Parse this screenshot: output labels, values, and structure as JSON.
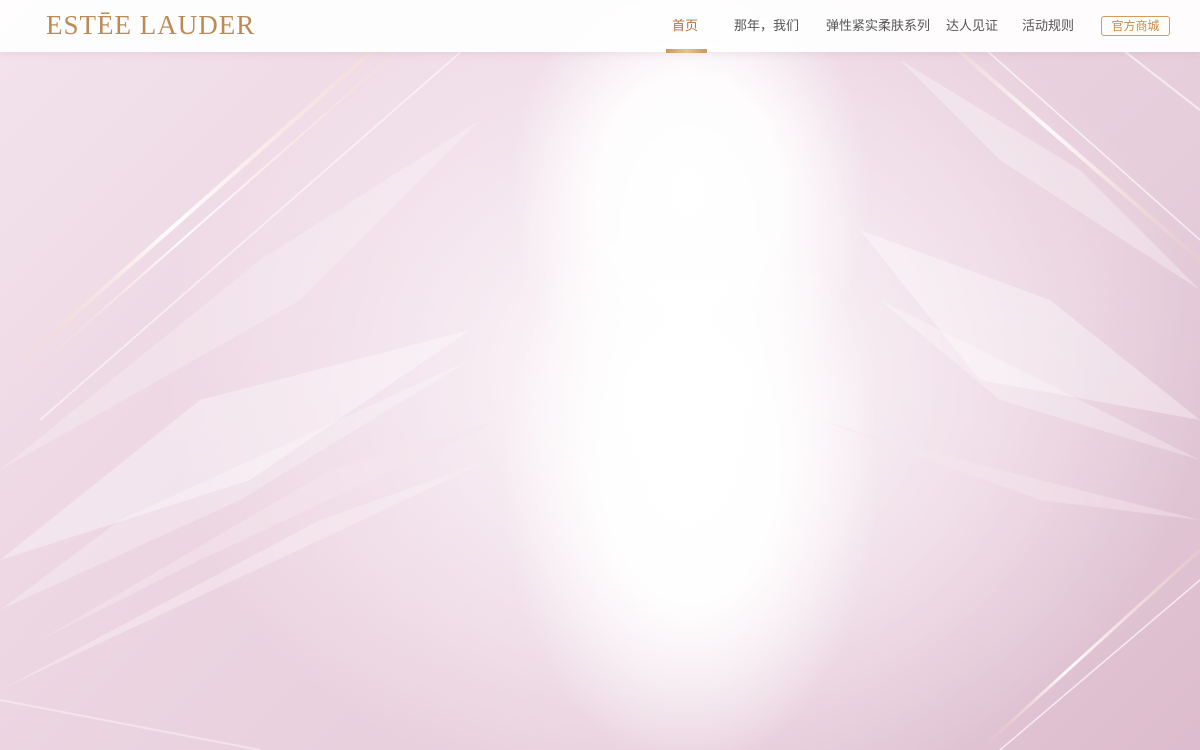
{
  "brand": {
    "logo_text": "ESTĒE LAUDER"
  },
  "nav": {
    "items": [
      {
        "label": "首页",
        "active": true
      },
      {
        "label": "那年，我们",
        "active": false
      },
      {
        "label": "弹性紧实柔肤系列",
        "active": false
      },
      {
        "label": "达人见证",
        "active": false
      },
      {
        "label": "活动规则",
        "active": false
      }
    ],
    "shop_button": "官方商城"
  },
  "colors": {
    "accent_gold": "#c58a4a",
    "active_nav": "#b0713a",
    "background_pink": "#ead6e0"
  }
}
